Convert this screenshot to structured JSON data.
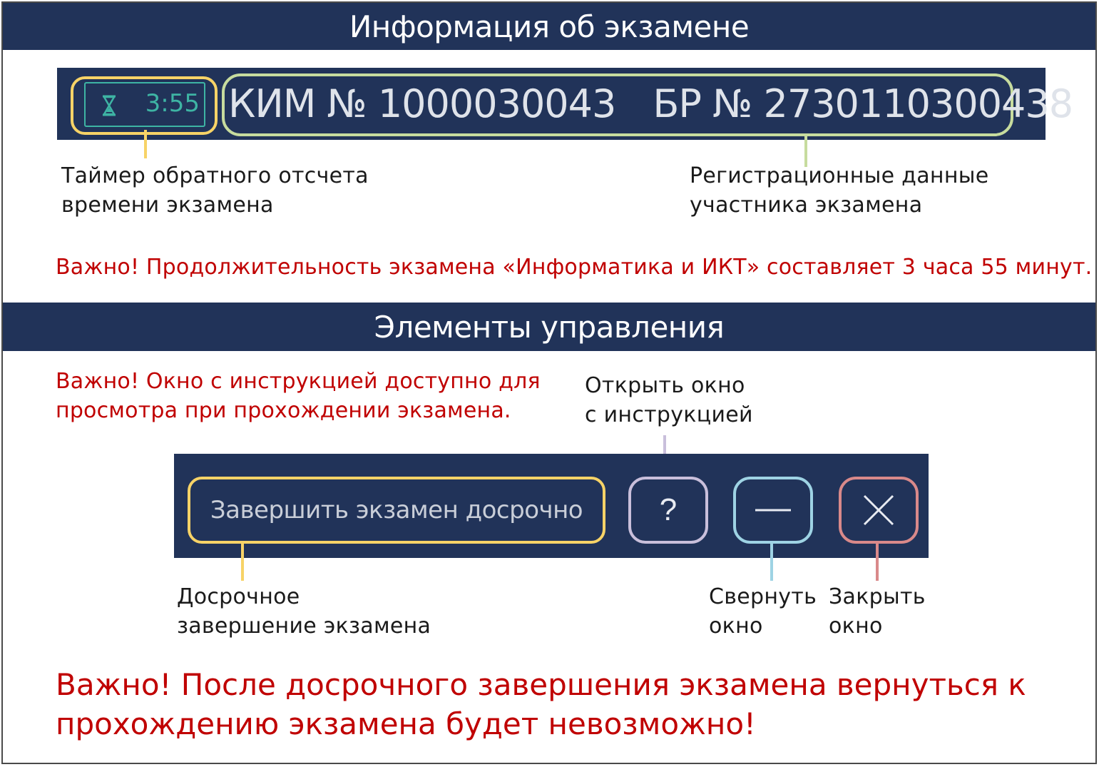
{
  "sections": {
    "exam_info_title": "Информация об экзамене",
    "controls_title": "Элементы управления"
  },
  "info_bar": {
    "timer_value": "3:55",
    "kim_label": "КИМ № 1000030043",
    "br_label": "БР № 2730110300438"
  },
  "captions": {
    "timer": "Таймер обратного отсчета\nвремени экзамена",
    "registration": "Регистрационные данные\nучастника экзамена",
    "open_instructions": "Открыть окно\nс инструкцией",
    "finish_early": "Досрочное\nзавершение экзамена",
    "minimize": "Свернуть\nокно",
    "close": "Закрыть\nокно"
  },
  "warnings": {
    "duration": "Важно! Продолжительность экзамена «Информатика и ИКТ» составляет 3 часа 55 минут.",
    "instructions": "Важно! Окно с инструкцией доступно для\nпросмотра при прохождении экзамена.",
    "no_return": "Важно! После досрочного завершения экзамена вернуться к\nпрохождению экзамена будет невозможно!"
  },
  "controls": {
    "finish_button": "Завершить экзамен досрочно",
    "help_button": "?"
  },
  "icons": {
    "timer": "hourglass-icon",
    "minimize": "minus-icon",
    "close": "x-icon"
  },
  "colors": {
    "bar_bg": "#213359",
    "timer_accent": "#3eb4a4",
    "highlight_yellow": "#f7d367",
    "highlight_green": "#c7dc9e",
    "highlight_lavender": "#c9bfdb",
    "highlight_blue": "#9ed3e4",
    "highlight_red": "#d9898a",
    "warning_text": "#c00000"
  }
}
